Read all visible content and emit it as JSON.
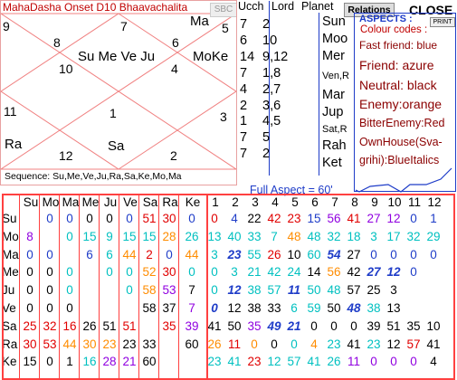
{
  "chart": {
    "title": "MahaDasha Onset D10 Bhaavachalita",
    "sbc_label": "SBC",
    "house_numbers": [
      "9",
      "8",
      "7",
      "6",
      "5",
      "10",
      "4",
      "11",
      "1",
      "3",
      "12",
      "2"
    ],
    "planets": {
      "center_top": "Su Me Ve Ju",
      "right_top": "MoKe",
      "left_mid": "Ma",
      "left_bottom": "Ra",
      "center_bottom": "Sa"
    },
    "sequence": "Sequence: Su,Me,Ve,Ju,Ra,Sa,Ke,Mo,Ma"
  },
  "lists": {
    "ucch_header": "Ucch",
    "lord_header": "Lord",
    "planet_header": "Planet",
    "ucch": [
      "7",
      "6",
      "14",
      "7",
      "4",
      "2",
      "1",
      "7",
      "7"
    ],
    "lord": [
      "2",
      "10",
      "9,12",
      "1,8",
      "2,7",
      "3,6",
      "4,5",
      "5",
      "2"
    ],
    "planets": [
      "Sun",
      "Moo",
      "Mer",
      "Ven,R",
      "Mar",
      "Jup",
      "Sat,R",
      "Rah",
      "Ket"
    ]
  },
  "toolbar": {
    "relations_label": "Relations",
    "close_label": "CLOSE",
    "print_label": "PRINT"
  },
  "aspects": {
    "title": "ASPECTS :",
    "colour_codes": "Colour codes :",
    "legend": [
      {
        "text": "Fast friend: blue"
      },
      {
        "text": "Friend: azure"
      },
      {
        "text": "Neutral: black"
      },
      {
        "text": "Enemy:orange"
      },
      {
        "text": "BitterEnemy:Red"
      },
      {
        "text": "OwnHouse(Sva-"
      },
      {
        "text": "grihi):BlueItalics"
      }
    ]
  },
  "full_aspect_label": "Full Aspect = 60'",
  "colors": {
    "red": "#e00000",
    "blue": "#1e3cc8",
    "azure": "#00c0c0",
    "purple": "#9000e0",
    "orange": "#ff8c00",
    "black": "#000000",
    "border": "#ff4040"
  },
  "grid": {
    "row_headers": [
      "Su",
      "Mo",
      "Ma",
      "Me",
      "Ju",
      "Ve",
      "Sa",
      "Ra",
      "Ke"
    ],
    "planet_headers": [
      "Su",
      "Mo",
      "Ma",
      "Me",
      "Ju",
      "Ve",
      "Sa",
      "Ra",
      "Ke"
    ],
    "house_headers": [
      "1",
      "2",
      "3",
      "4",
      "5",
      "6",
      "7",
      "8",
      "9",
      "10",
      "11",
      "12"
    ],
    "rows": [
      [
        [
          "",
          "k"
        ],
        [
          "0",
          "b"
        ],
        [
          "0",
          "b"
        ],
        [
          "0",
          "k"
        ],
        [
          "0",
          "k"
        ],
        [
          "0",
          "b"
        ],
        [
          "51",
          "r"
        ],
        [
          "30",
          "r"
        ],
        [
          "0",
          "b"
        ],
        [
          "0",
          "r"
        ],
        [
          "4",
          "b"
        ],
        [
          "22",
          "k"
        ],
        [
          "42",
          "r"
        ],
        [
          "23",
          "r"
        ],
        [
          "15",
          "b"
        ],
        [
          "56",
          "p"
        ],
        [
          "41",
          "r"
        ],
        [
          "27",
          "p"
        ],
        [
          "12",
          "p"
        ],
        [
          "0",
          "b"
        ],
        [
          "1",
          "b"
        ],
        [
          "",
          ""
        ]
      ],
      [
        [
          "8",
          "p"
        ],
        [
          "",
          "k"
        ],
        [
          "0",
          "a"
        ],
        [
          "15",
          "a"
        ],
        [
          "9",
          "a"
        ],
        [
          "15",
          "a"
        ],
        [
          "15",
          "a"
        ],
        [
          "28",
          "o"
        ],
        [
          "26",
          "a"
        ],
        [
          "13",
          "a"
        ],
        [
          "40",
          "a"
        ],
        [
          "33",
          "a"
        ],
        [
          "7",
          "a"
        ],
        [
          "48",
          "o"
        ],
        [
          "48",
          "a"
        ],
        [
          "32",
          "a"
        ],
        [
          "18",
          "a"
        ],
        [
          "3",
          "a"
        ],
        [
          "17",
          "a"
        ],
        [
          "32",
          "a"
        ],
        [
          "29",
          "a"
        ],
        [
          "",
          ""
        ]
      ],
      [
        [
          "0",
          "b"
        ],
        [
          "0",
          "b"
        ],
        [
          "",
          "k"
        ],
        [
          "6",
          "b"
        ],
        [
          "6",
          "a"
        ],
        [
          "44",
          "o"
        ],
        [
          "2",
          "r"
        ],
        [
          "0",
          "b"
        ],
        [
          "44",
          "o"
        ],
        [
          "3",
          "a"
        ],
        [
          "23",
          "bi"
        ],
        [
          "55",
          "a"
        ],
        [
          "26",
          "r"
        ],
        [
          "10",
          "k"
        ],
        [
          "60",
          "a"
        ],
        [
          "54",
          "bi"
        ],
        [
          "27",
          "k"
        ],
        [
          "0",
          "b"
        ],
        [
          "0",
          "b"
        ],
        [
          "0",
          "b"
        ],
        [
          "0",
          "b"
        ],
        [
          "",
          ""
        ]
      ],
      [
        [
          "0",
          "k"
        ],
        [
          "0",
          "k"
        ],
        [
          "0",
          "a"
        ],
        [
          "",
          "k"
        ],
        [
          "0",
          "a"
        ],
        [
          "0",
          "a"
        ],
        [
          "52",
          "o"
        ],
        [
          "30",
          "r"
        ],
        [
          "0",
          "a"
        ],
        [
          "0",
          "a"
        ],
        [
          "3",
          "a"
        ],
        [
          "21",
          "a"
        ],
        [
          "42",
          "a"
        ],
        [
          "24",
          "a"
        ],
        [
          "14",
          "k"
        ],
        [
          "56",
          "o"
        ],
        [
          "42",
          "k"
        ],
        [
          "27",
          "bi"
        ],
        [
          "12",
          "bi"
        ],
        [
          "0",
          "b"
        ],
        [
          "",
          ""
        ],
        [
          "",
          ""
        ]
      ],
      [
        [
          "0",
          "k"
        ],
        [
          "0",
          "k"
        ],
        [
          "0",
          "a"
        ],
        [
          "",
          "k"
        ],
        [
          "",
          "k"
        ],
        [
          "0",
          "a"
        ],
        [
          "58",
          "o"
        ],
        [
          "53",
          "p"
        ],
        [
          "7",
          "k"
        ],
        [
          "0",
          "a"
        ],
        [
          "12",
          "bi"
        ],
        [
          "38",
          "a"
        ],
        [
          "57",
          "a"
        ],
        [
          "11",
          "bi"
        ],
        [
          "50",
          "a"
        ],
        [
          "48",
          "a"
        ],
        [
          "57",
          "k"
        ],
        [
          "25",
          "k"
        ],
        [
          "3",
          "k"
        ],
        [
          "",
          ""
        ],
        [
          "",
          ""
        ],
        [
          "",
          ""
        ]
      ],
      [
        [
          "0",
          "k"
        ],
        [
          "0",
          "k"
        ],
        [
          "0",
          "k"
        ],
        [
          "",
          "k"
        ],
        [
          "",
          "k"
        ],
        [
          "",
          "k"
        ],
        [
          "58",
          "k"
        ],
        [
          "37",
          "k"
        ],
        [
          "7",
          "p"
        ],
        [
          "0",
          "bi"
        ],
        [
          "12",
          "k"
        ],
        [
          "38",
          "k"
        ],
        [
          "33",
          "k"
        ],
        [
          "6",
          "a"
        ],
        [
          "59",
          "a"
        ],
        [
          "50",
          "k"
        ],
        [
          "48",
          "bi"
        ],
        [
          "38",
          "a"
        ],
        [
          "13",
          "k"
        ],
        [
          "",
          ""
        ],
        [
          "",
          ""
        ],
        [
          "",
          ""
        ]
      ],
      [
        [
          "25",
          "r"
        ],
        [
          "32",
          "r"
        ],
        [
          "16",
          "r"
        ],
        [
          "26",
          "k"
        ],
        [
          "51",
          "k"
        ],
        [
          "51",
          "r"
        ],
        [
          "",
          "k"
        ],
        [
          "35",
          "r"
        ],
        [
          "39",
          "p"
        ],
        [
          "41",
          "k"
        ],
        [
          "50",
          "k"
        ],
        [
          "35",
          "p"
        ],
        [
          "49",
          "bi"
        ],
        [
          "21",
          "bi"
        ],
        [
          "0",
          "k"
        ],
        [
          "0",
          "k"
        ],
        [
          "0",
          "k"
        ],
        [
          "39",
          "k"
        ],
        [
          "51",
          "k"
        ],
        [
          "35",
          "k"
        ],
        [
          "10",
          "k"
        ],
        [
          "",
          ""
        ]
      ],
      [
        [
          "30",
          "r"
        ],
        [
          "53",
          "r"
        ],
        [
          "44",
          "o"
        ],
        [
          "30",
          "o"
        ],
        [
          "23",
          "o"
        ],
        [
          "23",
          "k"
        ],
        [
          "33",
          "k"
        ],
        [
          "",
          "k"
        ],
        [
          "60",
          "k"
        ],
        [
          "26",
          "o"
        ],
        [
          "11",
          "r"
        ],
        [
          "0",
          "o"
        ],
        [
          "0",
          "k"
        ],
        [
          "0",
          "a"
        ],
        [
          "4",
          "o"
        ],
        [
          "23",
          "a"
        ],
        [
          "41",
          "k"
        ],
        [
          "23",
          "a"
        ],
        [
          "12",
          "k"
        ],
        [
          "57",
          "r"
        ],
        [
          "41",
          "k"
        ],
        [
          "",
          ""
        ]
      ],
      [
        [
          "15",
          "k"
        ],
        [
          "0",
          "k"
        ],
        [
          "1",
          "k"
        ],
        [
          "16",
          "a"
        ],
        [
          "28",
          "p"
        ],
        [
          "21",
          "p"
        ],
        [
          "60",
          "k"
        ],
        [
          "",
          "k"
        ],
        [
          "",
          "k"
        ],
        [
          "23",
          "a"
        ],
        [
          "41",
          "a"
        ],
        [
          "23",
          "r"
        ],
        [
          "12",
          "a"
        ],
        [
          "57",
          "a"
        ],
        [
          "41",
          "a"
        ],
        [
          "26",
          "a"
        ],
        [
          "11",
          "p"
        ],
        [
          "0",
          "p"
        ],
        [
          "0",
          "p"
        ],
        [
          "0",
          "p"
        ],
        [
          "4",
          "k"
        ],
        [
          "",
          ""
        ]
      ]
    ]
  }
}
